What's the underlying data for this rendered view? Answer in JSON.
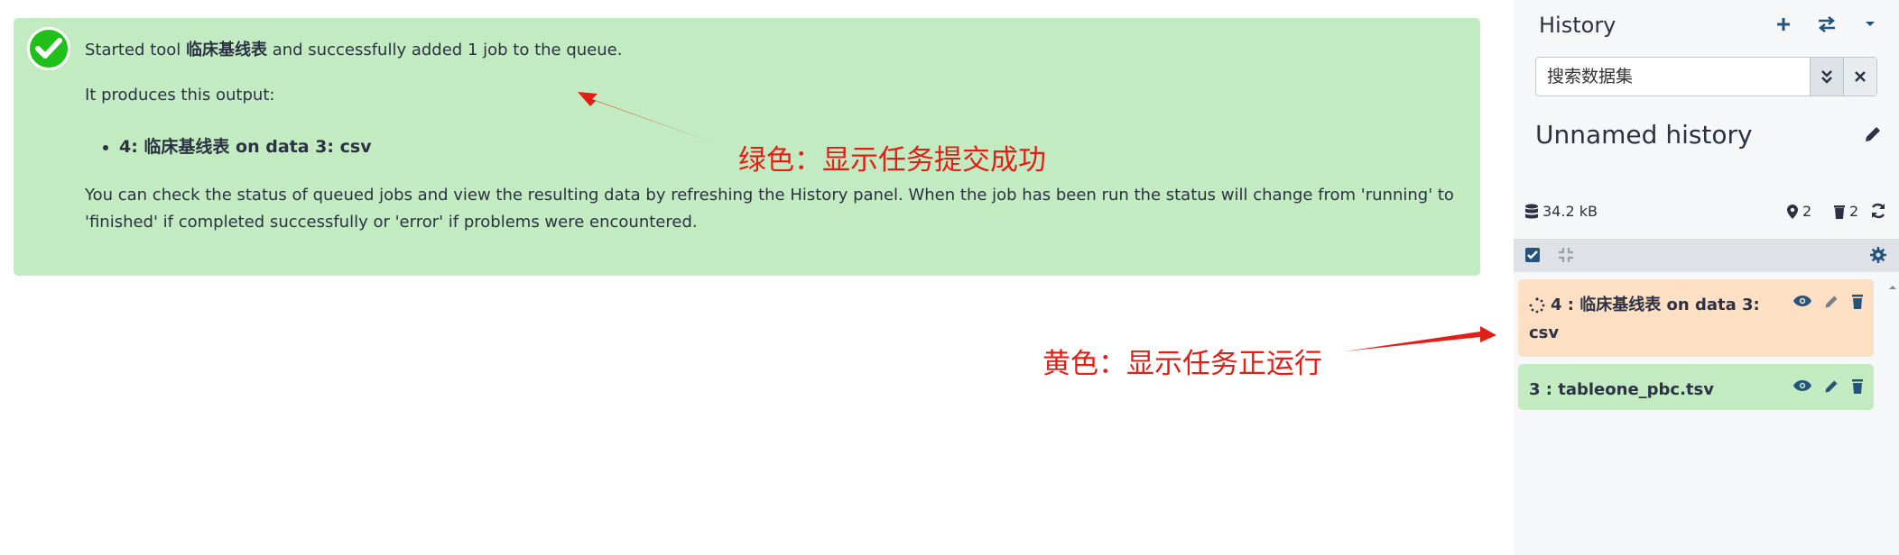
{
  "message": {
    "line1_prefix": "Started tool ",
    "tool_name": "临床基线表",
    "line1_suffix": " and successfully added 1 job to the queue.",
    "line2": "It produces this output:",
    "output_item": "4: 临床基线表 on data 3: csv",
    "line4": "You can check the status of queued jobs and view the resulting data by refreshing the History panel. When the job has been run the status will change from 'running' to 'finished' if completed successfully or 'error' if problems were encountered."
  },
  "annotations": {
    "green": "绿色：显示任务提交成功",
    "yellow": "黄色：显示任务正运行"
  },
  "history": {
    "title": "History",
    "search_placeholder": "搜索数据集",
    "name": "Unnamed history",
    "size": "34.2 kB",
    "shown_count": "2",
    "deleted_count": "2",
    "items": [
      {
        "label": "4 : 临床基线表 on data 3: csv",
        "state": "running",
        "color": "#fddfc4"
      },
      {
        "label": "3 : tableone_pbc.tsv",
        "state": "ok",
        "color": "#c2ebc1"
      }
    ]
  },
  "colors": {
    "success_bg": "#c2ebc1",
    "running_bg": "#fddfc4",
    "annotation": "#e02017",
    "icon": "#25537b"
  }
}
